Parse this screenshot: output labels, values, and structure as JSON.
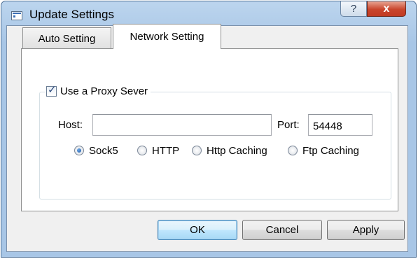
{
  "window": {
    "title": "Update Settings",
    "help_label": "?",
    "close_label": "x"
  },
  "tabs": [
    {
      "label": "Auto Setting",
      "active": false
    },
    {
      "label": "Network Setting",
      "active": true
    }
  ],
  "proxy": {
    "enabled_label": "Use a Proxy Sever",
    "enabled": true,
    "host_label": "Host:",
    "host_value": "",
    "port_label": "Port:",
    "port_value": "54448",
    "types": [
      {
        "label": "Sock5",
        "selected": true
      },
      {
        "label": "HTTP",
        "selected": false
      },
      {
        "label": "Http Caching",
        "selected": false
      },
      {
        "label": "Ftp Caching",
        "selected": false
      }
    ]
  },
  "buttons": {
    "ok": "OK",
    "cancel": "Cancel",
    "apply": "Apply"
  },
  "colors": {
    "frame": "#a8c6e6",
    "close": "#c9452c",
    "default_button": "#3c7fb1"
  }
}
